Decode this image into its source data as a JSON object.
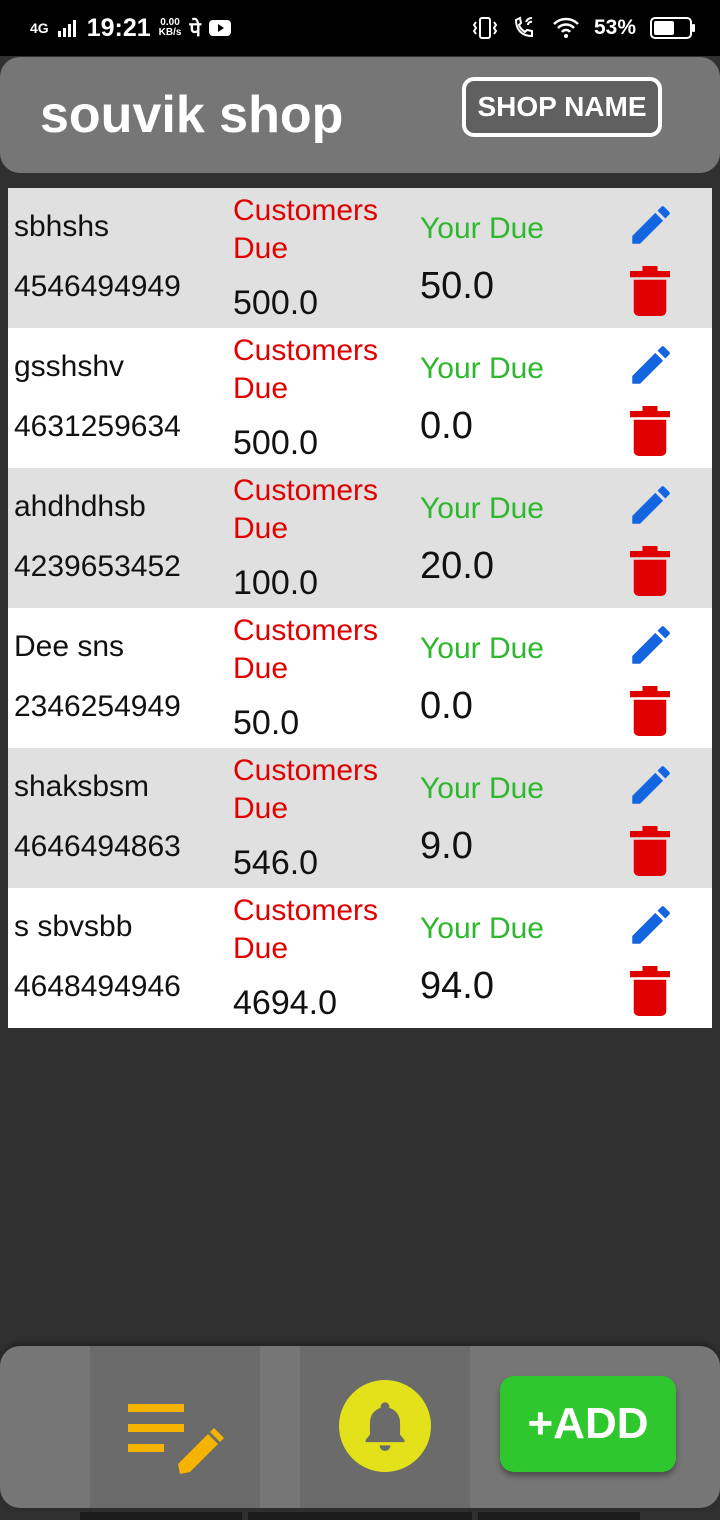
{
  "status_bar": {
    "network": "4G",
    "time": "19:21",
    "speed_value": "0.00",
    "speed_unit": "KB/s",
    "glyph": "पे",
    "battery_percent": "53%"
  },
  "header": {
    "title": "souvik shop",
    "shop_name_button": "SHOP NAME"
  },
  "list": {
    "customers_due_label": "Customers Due",
    "your_due_label": "Your Due",
    "rows": [
      {
        "name": "sbhshs",
        "phone": "4546494949",
        "customers_due": "500.0",
        "your_due": "50.0"
      },
      {
        "name": "gsshshv",
        "phone": "4631259634",
        "customers_due": "500.0",
        "your_due": "0.0"
      },
      {
        "name": "ahdhdhsb",
        "phone": "4239653452",
        "customers_due": "100.0",
        "your_due": "20.0"
      },
      {
        "name": "Dee sns",
        "phone": "2346254949",
        "customers_due": "50.0",
        "your_due": "0.0"
      },
      {
        "name": "shaksbsm",
        "phone": "4646494863",
        "customers_due": "546.0",
        "your_due": "9.0"
      },
      {
        "name": "s sbvsbb",
        "phone": "4648494946",
        "customers_due": "4694.0",
        "your_due": "94.0"
      }
    ]
  },
  "bottom_bar": {
    "add_button": "+ADD",
    "icons": [
      "list-edit-icon",
      "bell-icon"
    ]
  },
  "colors": {
    "header_bg": "#767676",
    "customers_due": "#e00000",
    "your_due": "#2db82d",
    "edit_icon": "#1565e0",
    "delete_icon": "#e00000",
    "add_button": "#2ec82e",
    "bell_circle": "#e3e21a",
    "list_icon": "#f5b400"
  }
}
